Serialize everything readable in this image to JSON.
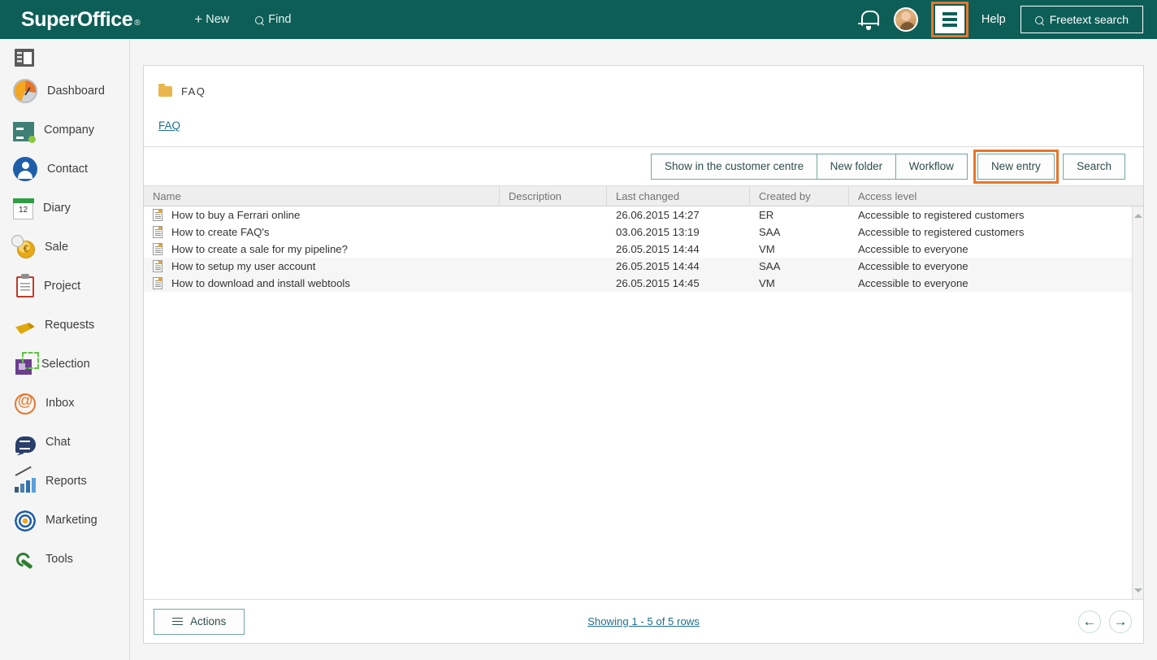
{
  "header": {
    "logo": "SuperOffice",
    "logo_reg": "®",
    "new_label": "New",
    "find_label": "Find",
    "help_label": "Help",
    "freetext_label": "Freetext search",
    "bell_icon": "bell-icon",
    "avatar_icon": "user-avatar",
    "menu_icon": "list-menu-icon",
    "accent_highlight": "#e8762a",
    "brand_color": "#0d5e57"
  },
  "sidebar": {
    "toggle_icon": "panel-toggle-icon",
    "items": [
      {
        "label": "Dashboard",
        "icon": "dashboard-icon"
      },
      {
        "label": "Company",
        "icon": "company-icon"
      },
      {
        "label": "Contact",
        "icon": "contact-icon"
      },
      {
        "label": "Diary",
        "icon": "calendar-icon"
      },
      {
        "label": "Sale",
        "icon": "coin-icon"
      },
      {
        "label": "Project",
        "icon": "clipboard-icon"
      },
      {
        "label": "Requests",
        "icon": "ticket-icon"
      },
      {
        "label": "Selection",
        "icon": "selection-icon"
      },
      {
        "label": "Inbox",
        "icon": "at-sign-icon"
      },
      {
        "label": "Chat",
        "icon": "chat-bubble-icon"
      },
      {
        "label": "Reports",
        "icon": "bar-chart-icon"
      },
      {
        "label": "Marketing",
        "icon": "target-icon"
      },
      {
        "label": "Tools",
        "icon": "wrench-icon"
      }
    ]
  },
  "content": {
    "folder_title": "FAQ",
    "folder_icon": "folder-icon",
    "breadcrumb": "FAQ",
    "toolbar": {
      "show_in_customer_centre": "Show in the customer centre",
      "new_folder": "New folder",
      "workflow": "Workflow",
      "new_entry": "New entry",
      "search": "Search"
    },
    "table": {
      "columns": [
        "Name",
        "Description",
        "Last changed",
        "Created by",
        "Access level"
      ],
      "rows": [
        {
          "name": "How to buy a Ferrari online",
          "description": "",
          "last_changed": "26.06.2015 14:27",
          "created_by": "ER",
          "access_level": "Accessible to registered customers",
          "highlighted": false
        },
        {
          "name": "How to create FAQ's",
          "description": "",
          "last_changed": "03.06.2015 13:19",
          "created_by": "SAA",
          "access_level": "Accessible to registered customers",
          "highlighted": false
        },
        {
          "name": "How to create a sale for my pipeline?",
          "description": "",
          "last_changed": "26.05.2015 14:44",
          "created_by": "VM",
          "access_level": "Accessible to everyone",
          "highlighted": false
        },
        {
          "name": "How to setup my user account",
          "description": "",
          "last_changed": "26.05.2015 14:44",
          "created_by": "SAA",
          "access_level": "Accessible to everyone",
          "highlighted": true
        },
        {
          "name": "How to download and install webtools",
          "description": "",
          "last_changed": "26.05.2015 14:45",
          "created_by": "VM",
          "access_level": "Accessible to everyone",
          "highlighted": true
        }
      ]
    },
    "footer": {
      "actions_label": "Actions",
      "showing_label": "Showing 1 - 5 of 5 rows",
      "prev_icon": "arrow-left-icon",
      "next_icon": "arrow-right-icon",
      "prev_glyph": "←",
      "next_glyph": "→"
    }
  }
}
